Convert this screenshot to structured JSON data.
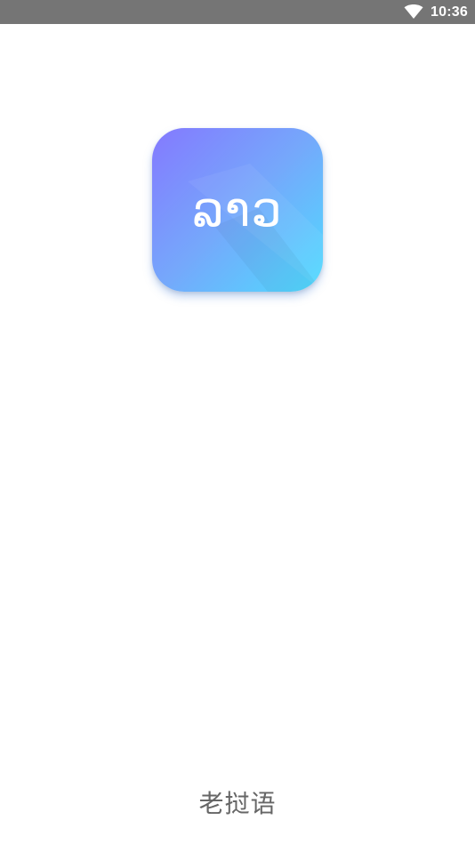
{
  "status_bar": {
    "time": "10:36",
    "wifi_icon": "wifi-icon",
    "background": "#757575"
  },
  "splash": {
    "logo_text": "ລາວ",
    "logo_gradient": [
      "#8479ff",
      "#75a8fb",
      "#4fdcff"
    ],
    "app_name": "老挝语"
  }
}
